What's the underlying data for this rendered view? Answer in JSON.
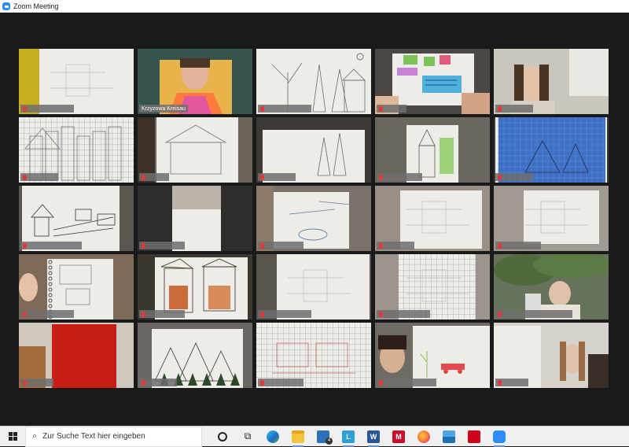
{
  "window": {
    "title": "Zoom Meeting"
  },
  "participants": [
    {
      "label": ""
    },
    {
      "label": "Krzyzowa Kreisau"
    },
    {
      "label": ""
    },
    {
      "label": ""
    },
    {
      "label": ""
    },
    {
      "label": ""
    },
    {
      "label": ""
    },
    {
      "label": ""
    },
    {
      "label": ""
    },
    {
      "label": ""
    },
    {
      "label": ""
    },
    {
      "label": ""
    },
    {
      "label": ""
    },
    {
      "label": ""
    },
    {
      "label": ""
    },
    {
      "label": ""
    },
    {
      "label": ""
    },
    {
      "label": ""
    },
    {
      "label": ""
    },
    {
      "label": ""
    },
    {
      "label": ""
    },
    {
      "label": ""
    },
    {
      "label": ""
    },
    {
      "label": ""
    },
    {
      "label": ""
    }
  ],
  "active_speaker_index": 1,
  "taskbar": {
    "search_placeholder": "Zur Suche Text hier eingeben",
    "icons": [
      {
        "name": "cortana-icon"
      },
      {
        "name": "task-view-icon"
      },
      {
        "name": "edge-icon"
      },
      {
        "name": "file-explorer-icon"
      },
      {
        "name": "mail-icon",
        "badge": "4"
      },
      {
        "name": "lexicon-l-icon",
        "letter": "L"
      },
      {
        "name": "word-icon",
        "letter": "W"
      },
      {
        "name": "mcafee-icon",
        "letter": "M"
      },
      {
        "name": "firefox-icon"
      },
      {
        "name": "photos-icon"
      },
      {
        "name": "acrobat-icon"
      },
      {
        "name": "zoom-icon"
      }
    ]
  },
  "colors": {
    "active_border": "#d6e86a",
    "zoom_blue": "#2d8cff",
    "mute_red": "#e03a3a"
  }
}
